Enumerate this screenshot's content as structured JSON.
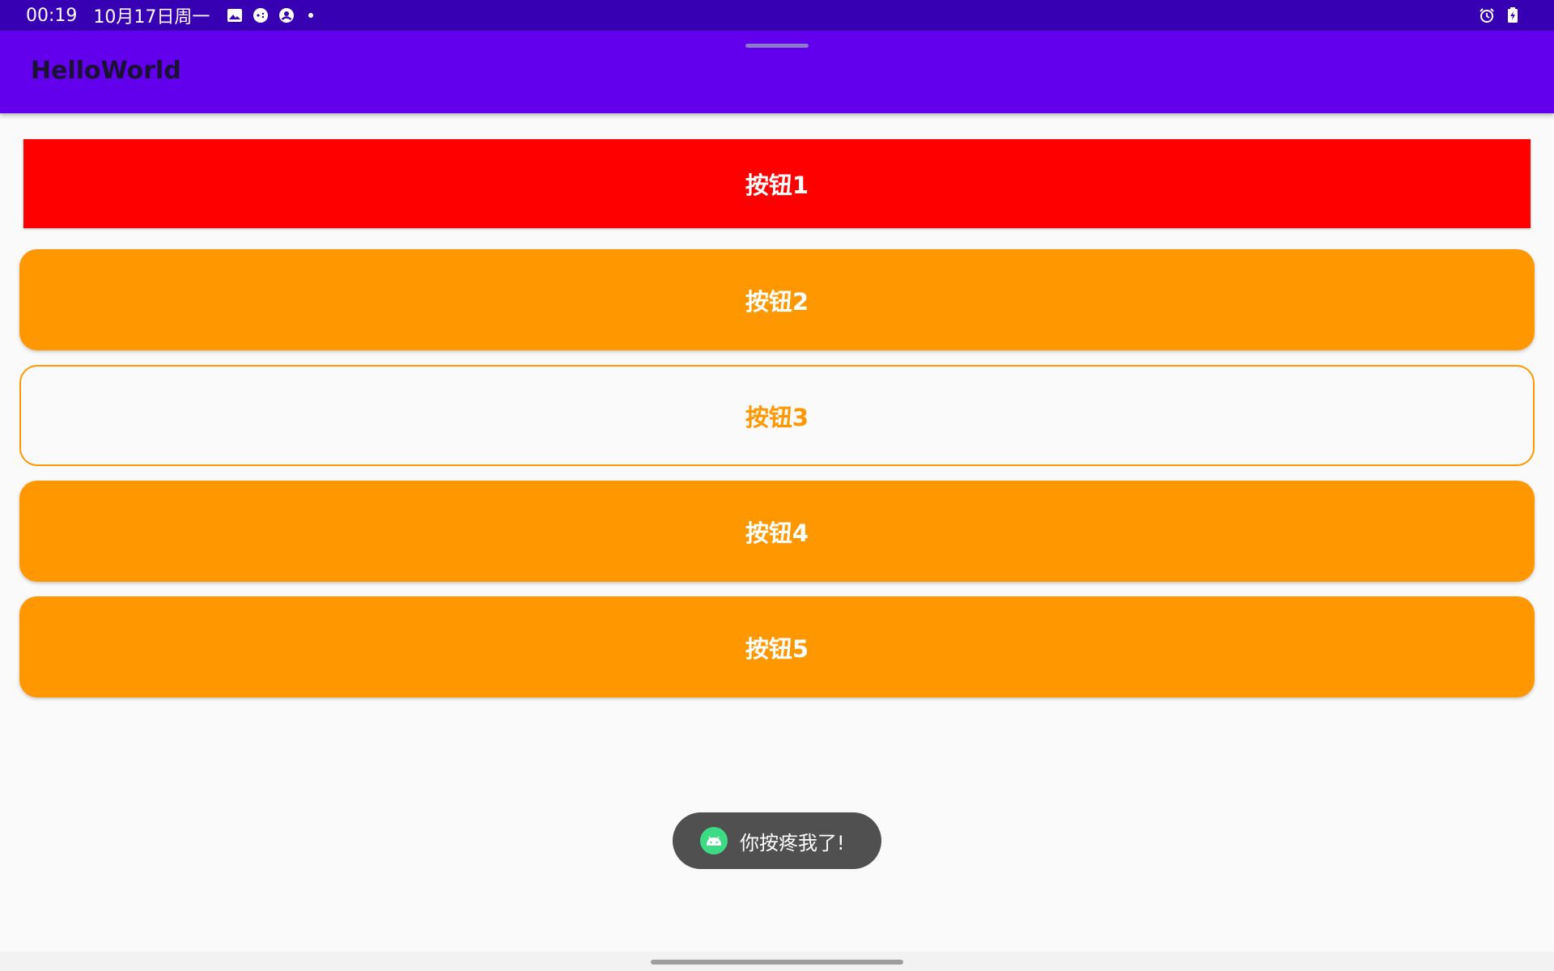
{
  "status_bar": {
    "time": "00:19",
    "date": "10月17日周一",
    "left_icons": [
      "image-icon",
      "game-controller-icon",
      "account-icon"
    ],
    "right_icons": [
      "alarm-icon",
      "battery-icon"
    ]
  },
  "app_bar": {
    "title": "HelloWorld",
    "background_color": "#6200EE"
  },
  "buttons": [
    {
      "label": "按钮1",
      "style": "filled-rect",
      "color": "#FF0000"
    },
    {
      "label": "按钮2",
      "style": "filled-rounded",
      "color": "#FF9800"
    },
    {
      "label": "按钮3",
      "style": "outlined-rounded",
      "color": "#FF9800"
    },
    {
      "label": "按钮4",
      "style": "filled-rounded",
      "color": "#FF9800"
    },
    {
      "label": "按钮5",
      "style": "filled-rounded",
      "color": "#FF9800"
    }
  ],
  "toast": {
    "message": "你按疼我了!",
    "icon": "android-icon"
  }
}
